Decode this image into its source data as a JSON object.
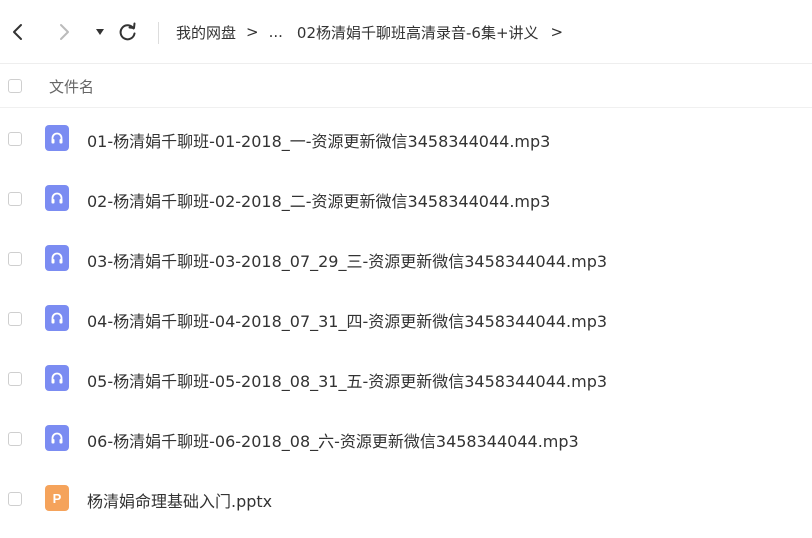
{
  "breadcrumb": {
    "root": "我的网盘",
    "separator": ">",
    "ellipsis": "...",
    "current": "02杨清娟千聊班高清录音-6集+讲义",
    "trailing_separator": ">"
  },
  "list_header": {
    "name_column": "文件名"
  },
  "files": [
    {
      "name": "01-杨清娟千聊班-01-2018_一-资源更新微信3458344044.mp3",
      "type": "audio",
      "icon": "headphones-icon"
    },
    {
      "name": "02-杨清娟千聊班-02-2018_二-资源更新微信3458344044.mp3",
      "type": "audio",
      "icon": "headphones-icon"
    },
    {
      "name": "03-杨清娟千聊班-03-2018_07_29_三-资源更新微信3458344044.mp3",
      "type": "audio",
      "icon": "headphones-icon"
    },
    {
      "name": "04-杨清娟千聊班-04-2018_07_31_四-资源更新微信3458344044.mp3",
      "type": "audio",
      "icon": "headphones-icon"
    },
    {
      "name": "05-杨清娟千聊班-05-2018_08_31_五-资源更新微信3458344044.mp3",
      "type": "audio",
      "icon": "headphones-icon"
    },
    {
      "name": "06-杨清娟千聊班-06-2018_08_六-资源更新微信3458344044.mp3",
      "type": "audio",
      "icon": "headphones-icon"
    },
    {
      "name": "杨清娟命理基础入门.pptx",
      "type": "ppt",
      "icon": "ppt-file-icon",
      "icon_letter": "P"
    }
  ],
  "colors": {
    "audio_icon": "#7b8cf2",
    "ppt_icon": "#f5a35b",
    "text": "#333333",
    "muted_text": "#666666"
  }
}
